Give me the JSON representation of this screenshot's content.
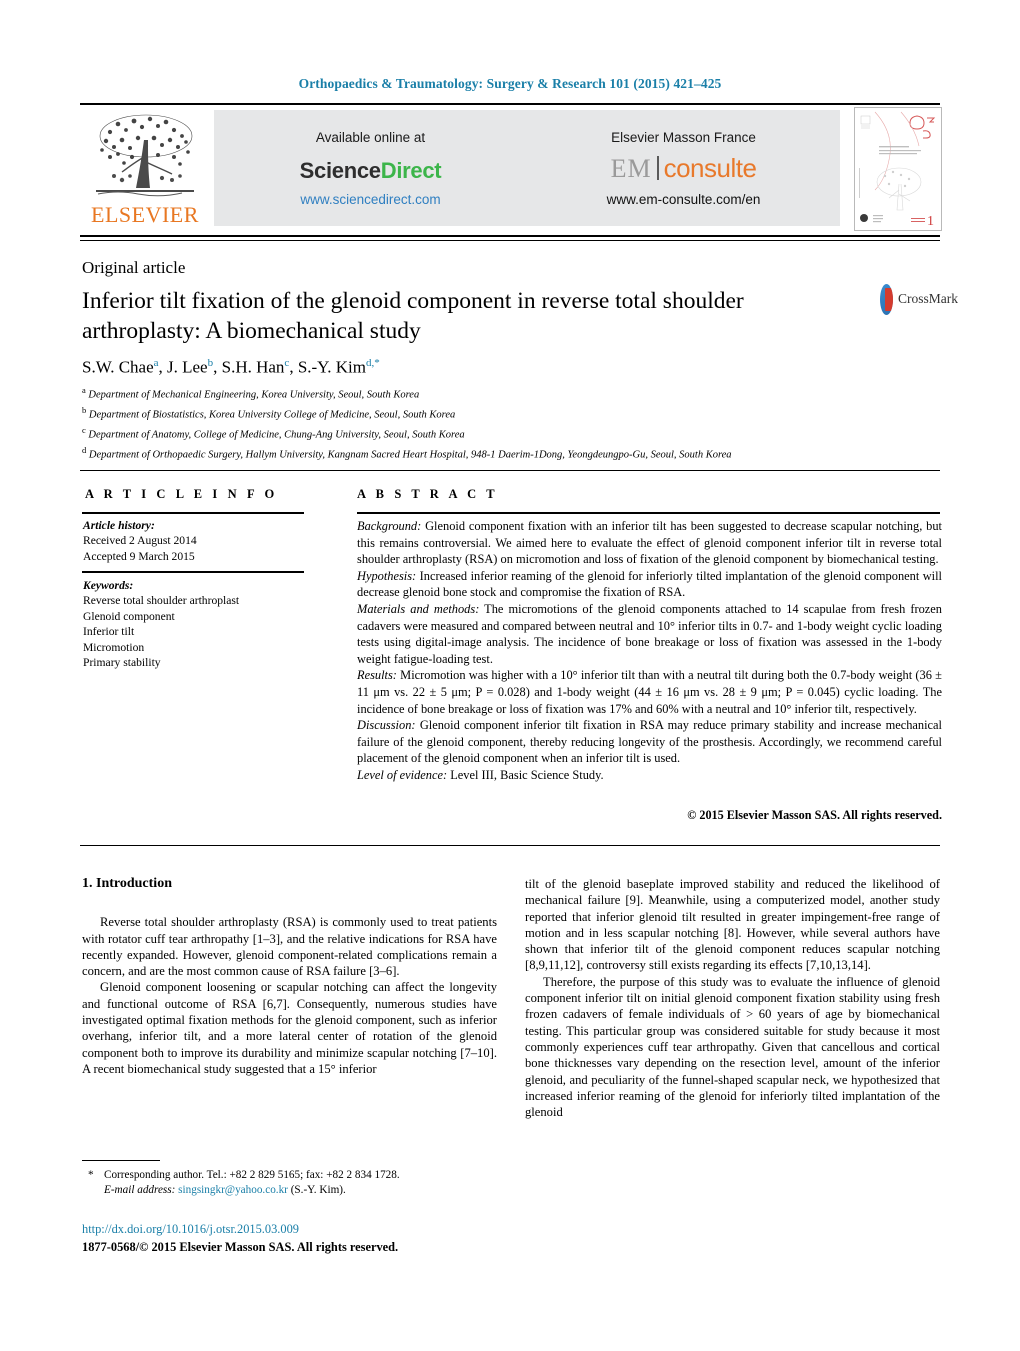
{
  "running_head": "Orthopaedics & Traumatology: Surgery & Research 101 (2015) 421–425",
  "colors": {
    "link_blue": "#1a7fa8",
    "elsevier_orange": "#e87722",
    "sciencedirect_green": "#3cb54a",
    "emconsulte_orange": "#e8792b",
    "banner_grey": "#e6e7e8"
  },
  "header": {
    "elsevier_wordmark": "ELSEVIER",
    "sciencedirect": {
      "available_at": "Available online at",
      "brand_part1": "Science",
      "brand_part2": "Direct",
      "url": "www.sciencedirect.com"
    },
    "emconsulte": {
      "publisher": "Elsevier Masson France",
      "brand_part1": "EM",
      "brand_part2": "consulte",
      "url": "www.em-consulte.com/en"
    },
    "cover_thumb_alt": "journal-cover-thumbnail"
  },
  "article": {
    "type": "Original article",
    "title": "Inferior tilt fixation of the glenoid component in reverse total shoulder arthroplasty: A biomechanical study",
    "crossmark_label": "CrossMark",
    "authors": "S.W. Chae, J. Lee, S.H. Han, S.-Y. Kim",
    "author_list": [
      {
        "name": "S.W. Chae",
        "marks": "a"
      },
      {
        "name": "J. Lee",
        "marks": "b"
      },
      {
        "name": "S.H. Han",
        "marks": "c"
      },
      {
        "name": "S.-Y. Kim",
        "marks": "d,*"
      }
    ],
    "affiliations": [
      {
        "label": "a",
        "text": "Department of Mechanical Engineering, Korea University, Seoul, South Korea"
      },
      {
        "label": "b",
        "text": "Department of Biostatistics, Korea University College of Medicine, Seoul, South Korea"
      },
      {
        "label": "c",
        "text": "Department of Anatomy, College of Medicine, Chung-Ang University, Seoul, South Korea"
      },
      {
        "label": "d",
        "text": "Department of Orthopaedic Surgery, Hallym University, Kangnam Sacred Heart Hospital, 948-1 Daerim-1Dong, Yeongdeungpo-Gu, Seoul, South Korea"
      }
    ]
  },
  "article_info": {
    "heading": "A R T I C L E   I N F O",
    "history_label": "Article history:",
    "received": "Received 2 August 2014",
    "accepted": "Accepted 9 March 2015",
    "keywords_label": "Keywords:",
    "keywords": [
      "Reverse total shoulder arthroplast",
      "Glenoid component",
      "Inferior tilt",
      "Micromotion",
      "Primary stability"
    ]
  },
  "abstract": {
    "heading": "A B S T R A C T",
    "sections": [
      {
        "label": "Background:",
        "text": "Glenoid component fixation with an inferior tilt has been suggested to decrease scapular notching, but this remains controversial. We aimed here to evaluate the effect of glenoid component inferior tilt in reverse total shoulder arthroplasty (RSA) on micromotion and loss of fixation of the glenoid component by biomechanical testing."
      },
      {
        "label": "Hypothesis:",
        "text": "Increased inferior reaming of the glenoid for inferiorly tilted implantation of the glenoid component will decrease glenoid bone stock and compromise the fixation of RSA."
      },
      {
        "label": "Materials and methods:",
        "text": "The micromotions of the glenoid components attached to 14 scapulae from fresh frozen cadavers were measured and compared between neutral and 10° inferior tilts in 0.7- and 1-body weight cyclic loading tests using digital-image analysis. The incidence of bone breakage or loss of fixation was assessed in the 1-body weight fatigue-loading test."
      },
      {
        "label": "Results:",
        "text": "Micromotion was higher with a 10° inferior tilt than with a neutral tilt during both the 0.7-body weight (36 ± 11 μm vs. 22 ± 5 μm; P = 0.028) and 1-body weight (44 ± 16 μm vs. 28 ± 9 μm; P = 0.045) cyclic loading. The incidence of bone breakage or loss of fixation was 17% and 60% with a neutral and 10° inferior tilt, respectively."
      },
      {
        "label": "Discussion:",
        "text": "Glenoid component inferior tilt fixation in RSA may reduce primary stability and increase mechanical failure of the glenoid component, thereby reducing longevity of the prosthesis. Accordingly, we recommend careful placement of the glenoid component when an inferior tilt is used."
      },
      {
        "label": "Level of evidence:",
        "text": "Level III, Basic Science Study."
      }
    ],
    "copyright": "© 2015 Elsevier Masson SAS. All rights reserved."
  },
  "body": {
    "section_number_title": "1. Introduction",
    "left_paragraphs": [
      "Reverse total shoulder arthroplasty (RSA) is commonly used to treat patients with rotator cuff tear arthropathy [1–3], and the relative indications for RSA have recently expanded. However, glenoid component-related complications remain a concern, and are the most common cause of RSA failure [3–6].",
      "Glenoid component loosening or scapular notching can affect the longevity and functional outcome of RSA [6,7]. Consequently, numerous studies have investigated optimal fixation methods for the glenoid component, such as inferior overhang, inferior tilt, and a more lateral center of rotation of the glenoid component both to improve its durability and minimize scapular notching [7–10]. A recent biomechanical study suggested that a 15° inferior"
    ],
    "right_paragraphs": [
      "tilt of the glenoid baseplate improved stability and reduced the likelihood of mechanical failure [9]. Meanwhile, using a computerized model, another study reported that inferior glenoid tilt resulted in greater impingement-free range of motion and in less scapular notching [8]. However, while several authors have shown that inferior tilt of the glenoid component reduces scapular notching [8,9,11,12], controversy still exists regarding its effects [7,10,13,14].",
      "Therefore, the purpose of this study was to evaluate the influence of glenoid component inferior tilt on initial glenoid component fixation stability using fresh frozen cadavers of female individuals of > 60 years of age by biomechanical testing. This particular group was considered suitable for study because it most commonly experiences cuff tear arthropathy. Given that cancellous and cortical bone thicknesses vary depending on the resection level, amount of the inferior glenoid, and peculiarity of the funnel-shaped scapular neck, we hypothesized that increased inferior reaming of the glenoid for inferiorly tilted implantation of the glenoid"
    ]
  },
  "footer": {
    "corresponding_star": "*",
    "corresponding_author": "Corresponding author. Tel.: +82 2 829 5165; fax: +82 2 834 1728.",
    "email_label": "E-mail address:",
    "email": "singsingkr@yahoo.co.kr",
    "email_owner": "(S.-Y. Kim).",
    "doi": "http://dx.doi.org/10.1016/j.otsr.2015.03.009",
    "issn_line": "1877-0568/© 2015 Elsevier Masson SAS. All rights reserved."
  }
}
